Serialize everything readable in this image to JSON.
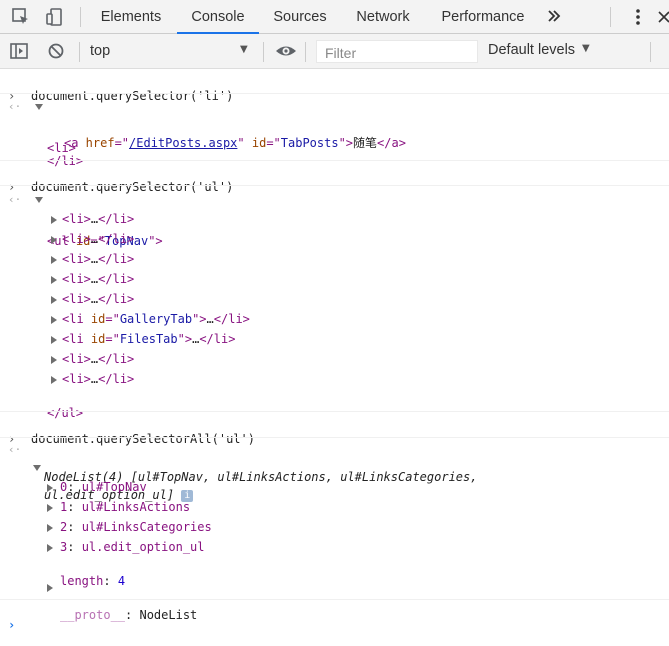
{
  "tabs": [
    "Elements",
    "Console",
    "Sources",
    "Network",
    "Performance"
  ],
  "toolbar": {
    "context": "top",
    "filter_placeholder": "Filter",
    "levels": "Default levels"
  },
  "entries": [
    {
      "command": "document.querySelector('li')",
      "li_open": "<li>",
      "a_open": "<a",
      "a_href_attr": " href",
      "a_href_eq": "=\"",
      "a_href_val": "/EditPosts.aspx",
      "a_href_close": "\"",
      "a_id_attr": " id",
      "a_id_eq": "=\"",
      "a_id_val": "TabPosts",
      "a_id_close": "\">",
      "a_text": "随笔",
      "a_close": "</a>",
      "li_close": "</li>"
    },
    {
      "command": "document.querySelector('ul')",
      "ul_open_tag": "<ul",
      "ul_id_attr": " id",
      "ul_id_eq": "=\"",
      "ul_id_val": "TopNav",
      "ul_id_close": "\">",
      "children": [
        {
          "pre": "<li>",
          "mid": "…",
          "post": "</li>"
        },
        {
          "pre": "<li>",
          "mid": "…",
          "post": "</li>"
        },
        {
          "pre": "<li>",
          "mid": "…",
          "post": "</li>"
        },
        {
          "pre": "<li>",
          "mid": "…",
          "post": "</li>"
        },
        {
          "pre": "<li>",
          "mid": "…",
          "post": "</li>"
        },
        {
          "pre": "<li",
          "attr": " id",
          "eq": "=\"",
          "val": "GalleryTab",
          "close": "\">",
          "mid": "…",
          "post": "</li>"
        },
        {
          "pre": "<li",
          "attr": " id",
          "eq": "=\"",
          "val": "FilesTab",
          "close": "\">",
          "mid": "…",
          "post": "</li>"
        },
        {
          "pre": "<li>",
          "mid": "…",
          "post": "</li>"
        },
        {
          "pre": "<li>",
          "mid": "…",
          "post": "</li>"
        }
      ],
      "ul_close": "</ul>"
    },
    {
      "command": "document.querySelectorAll('ul')",
      "summary_line1": "NodeList(4) [ul#TopNav, ul#LinksActions, ul#LinksCategories,",
      "summary_line2": "ul.edit_option_ul]",
      "items": [
        {
          "key": "0",
          "value": "ul#TopNav"
        },
        {
          "key": "1",
          "value": "ul#LinksActions"
        },
        {
          "key": "2",
          "value": "ul#LinksCategories"
        },
        {
          "key": "3",
          "value": "ul.edit_option_ul"
        }
      ],
      "length_key": "length",
      "length_value": "4",
      "proto_key": "__proto__",
      "proto_value": "NodeList"
    }
  ],
  "colors": {
    "accent": "#1a73e8",
    "tag": "#881280",
    "attr": "#994500",
    "value": "#1a1aa6",
    "string": "#c41a16"
  }
}
